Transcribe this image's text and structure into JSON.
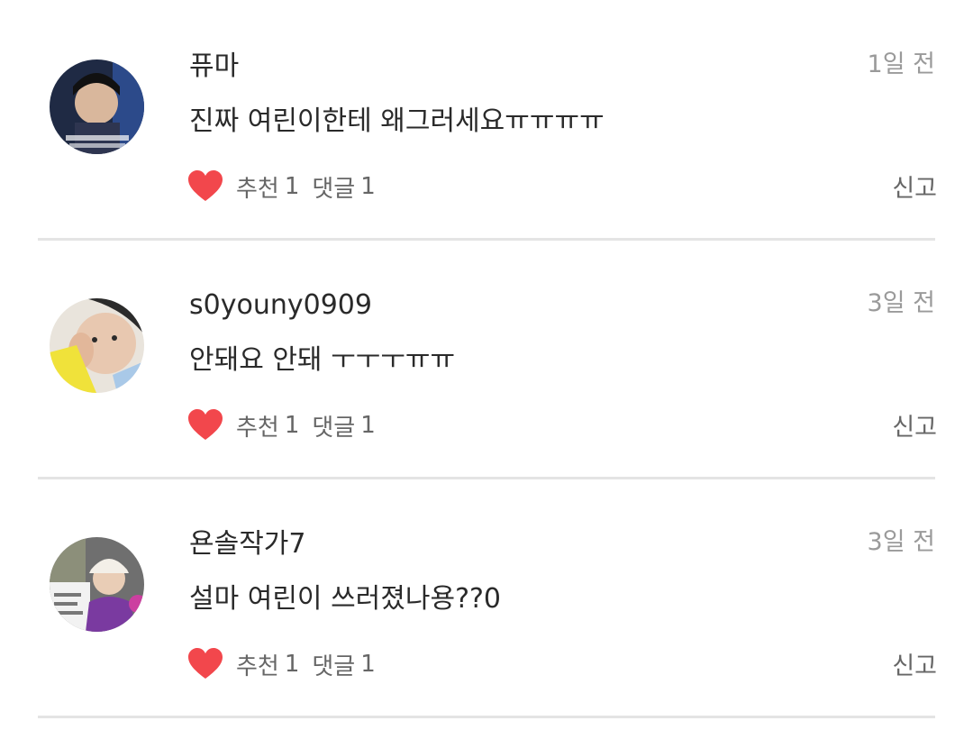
{
  "comments": [
    {
      "username": "퓨마",
      "time": "1일 전",
      "text": "진짜 여린이한테 왜그러세요ㅠㅠㅠㅠ",
      "like_label": "추천",
      "like_count": "1",
      "reply_label": "댓글",
      "reply_count": "1",
      "report_label": "신고"
    },
    {
      "username": "s0youny0909",
      "time": "3일 전",
      "text": "안돼요 안돼 ㅜㅜㅜㅠㅠ",
      "like_label": "추천",
      "like_count": "1",
      "reply_label": "댓글",
      "reply_count": "1",
      "report_label": "신고"
    },
    {
      "username": "욘솔작가7",
      "time": "3일 전",
      "text": "설마 여린이 쓰러졌나용??0",
      "like_label": "추천",
      "like_count": "1",
      "reply_label": "댓글",
      "reply_count": "1",
      "report_label": "신고"
    }
  ],
  "colors": {
    "heart": "#f2474c",
    "divider": "#e4e4e4",
    "text_primary": "#2a2a2a",
    "text_muted": "#9a9a9a",
    "text_secondary": "#666666"
  },
  "icons": {
    "like": "heart-icon"
  }
}
